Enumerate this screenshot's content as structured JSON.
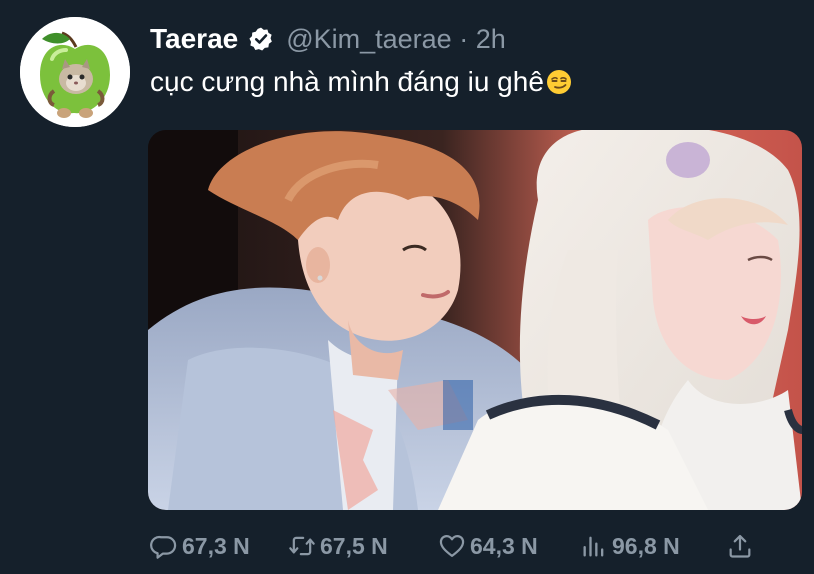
{
  "tweet": {
    "display_name": "Taerae",
    "handle": "@Kim_taerae · 2h",
    "text": "cục cưng nhà mình đáng iu ghê",
    "emoji": "smirking-face-emoji",
    "verified": true
  },
  "actions": {
    "replies": "67,3 N",
    "retweets": "67,5 N",
    "likes": "64,3 N",
    "views": "96,8 N"
  },
  "colors": {
    "background": "#15202b",
    "text_primary": "#ffffff",
    "text_secondary": "#8b98a5",
    "avatar_apple": "#7cc13c"
  },
  "icons": [
    "verified-badge-icon",
    "reply-icon",
    "retweet-icon",
    "like-icon",
    "views-icon",
    "share-icon"
  ]
}
